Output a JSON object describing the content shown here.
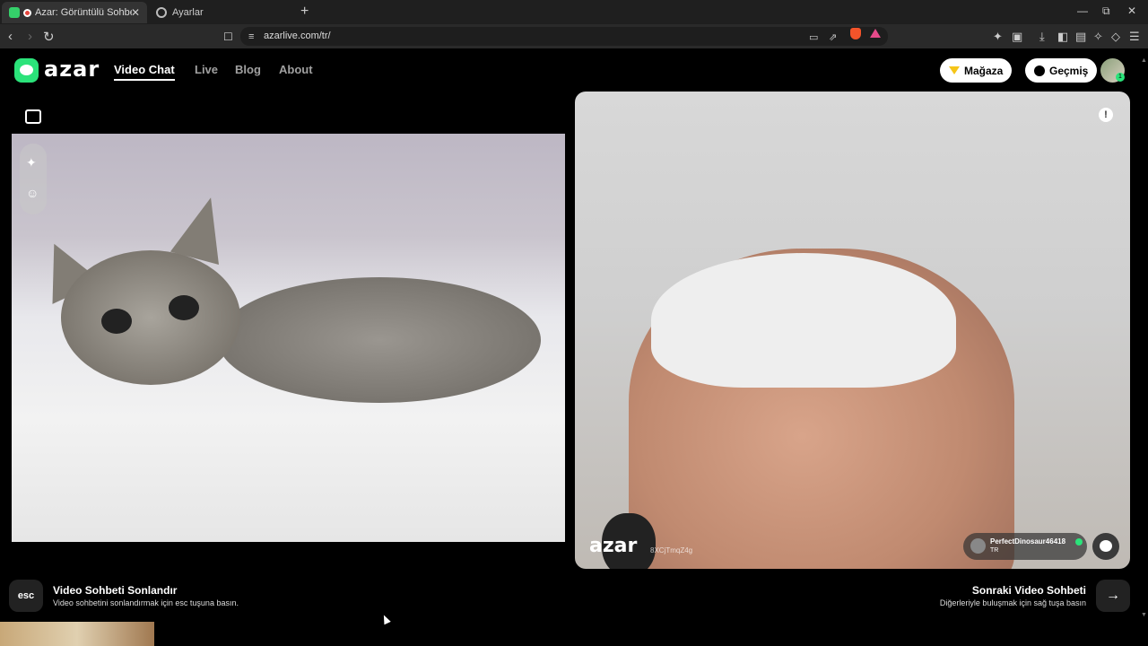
{
  "browser": {
    "tabs": [
      {
        "title": "Azar: Görüntülü Sohbet, Yeni",
        "close": "✕"
      },
      {
        "title": "Ayarlar"
      }
    ],
    "new_tab": "+",
    "window_controls": {
      "minimize": "—",
      "restore": "⧉",
      "close": "✕"
    },
    "nav": {
      "back": "‹",
      "forward": "›",
      "reload": "↻"
    },
    "address": "azarlive.com/tr/"
  },
  "site": {
    "logo": "azar",
    "nav": [
      "Video Chat",
      "Live",
      "Blog",
      "About"
    ],
    "shop_label": "Mağaza",
    "history_label": "Geçmiş",
    "avatar_badge": "1"
  },
  "remote": {
    "watermark": "azar",
    "watermark_code": "8XCjTmqZ4g",
    "report": "!",
    "user_name": "PerfectDinosaur46418",
    "user_country": "TR"
  },
  "footer": {
    "esc_key": "esc",
    "end_title": "Video Sohbeti Sonlandır",
    "end_sub": "Video sohbetini sonlandırmak için esc tuşuna basın.",
    "next_title": "Sonraki Video Sohbeti",
    "next_sub": "Diğerleriyle buluşmak için sağ tuşa basın",
    "next_arrow": "→"
  },
  "colors": {
    "brand": "#2be37a",
    "background": "#000000"
  }
}
